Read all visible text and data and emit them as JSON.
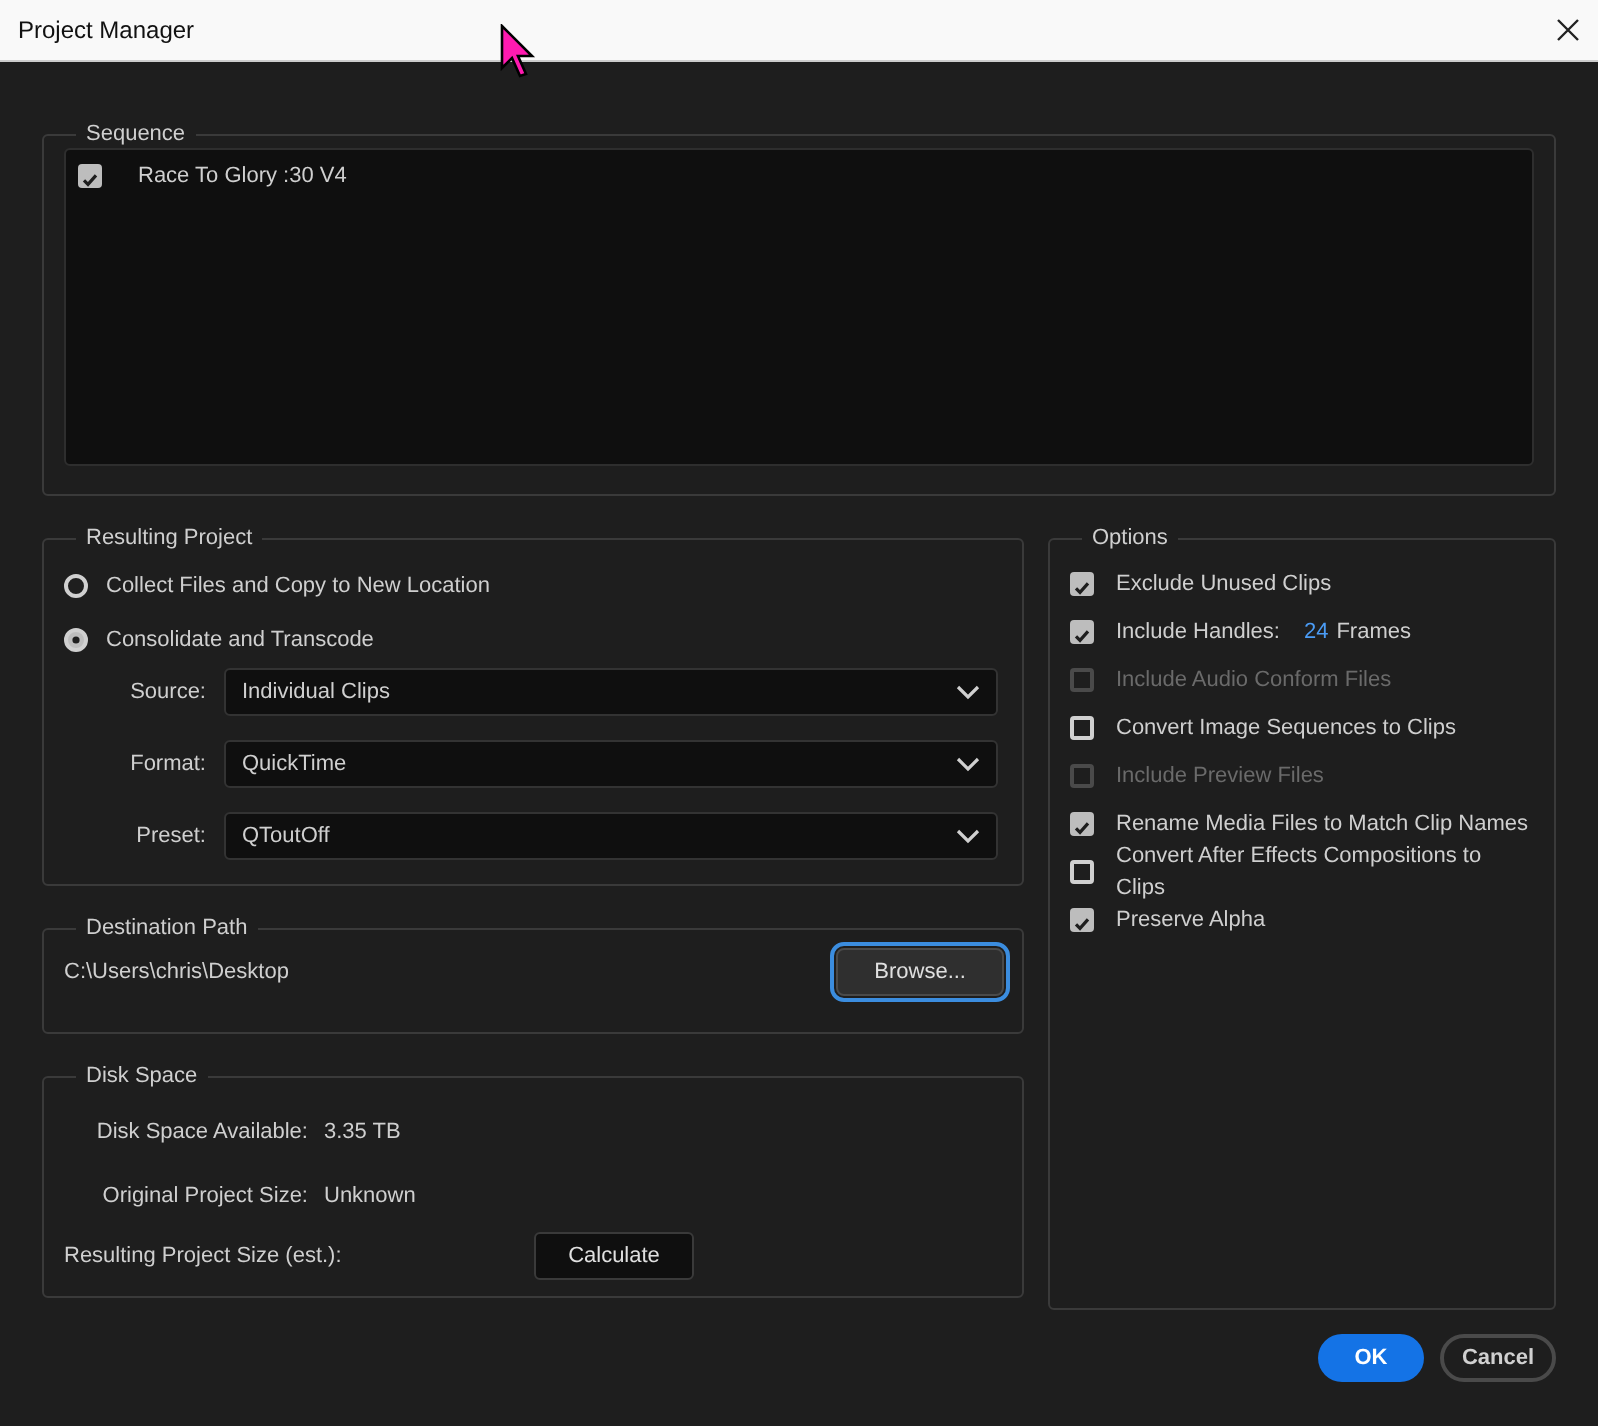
{
  "window": {
    "title": "Project Manager"
  },
  "sequence": {
    "legend": "Sequence",
    "items": [
      {
        "label": "Race To Glory :30 V4",
        "checked": true
      }
    ]
  },
  "resulting_project": {
    "legend": "Resulting Project",
    "modes": [
      {
        "label": "Collect Files and Copy to New Location",
        "selected": false
      },
      {
        "label": "Consolidate and Transcode",
        "selected": true
      }
    ],
    "fields": [
      {
        "label": "Source:",
        "value": "Individual Clips"
      },
      {
        "label": "Format:",
        "value": "QuickTime"
      },
      {
        "label": "Preset:",
        "value": "QToutOff"
      }
    ]
  },
  "destination_path": {
    "legend": "Destination Path",
    "path": "C:\\Users\\chris\\Desktop",
    "button": "Browse..."
  },
  "disk_space": {
    "legend": "Disk Space",
    "rows": [
      {
        "label": "Disk Space Available:",
        "value": "3.35 TB"
      },
      {
        "label": "Original Project Size:",
        "value": "Unknown"
      }
    ],
    "estimate_label": "Resulting Project Size (est.):",
    "button": "Calculate"
  },
  "options": {
    "legend": "Options",
    "items": [
      {
        "label": "Exclude Unused Clips",
        "checked": true,
        "disabled": false
      },
      {
        "label": "Include Handles:",
        "checked": true,
        "disabled": false,
        "value": "24",
        "unit": "Frames"
      },
      {
        "label": "Include Audio Conform Files",
        "checked": false,
        "disabled": true
      },
      {
        "label": "Convert Image Sequences to Clips",
        "checked": false,
        "disabled": false
      },
      {
        "label": "Include Preview Files",
        "checked": false,
        "disabled": true
      },
      {
        "label": "Rename Media Files to Match Clip Names",
        "checked": true,
        "disabled": false
      },
      {
        "label": "Convert After Effects Compositions to Clips",
        "checked": false,
        "disabled": false
      },
      {
        "label": "Preserve Alpha",
        "checked": true,
        "disabled": false
      }
    ]
  },
  "buttons": [
    {
      "label": "OK",
      "kind": "primary"
    },
    {
      "label": "Cancel",
      "kind": "secondary"
    }
  ]
}
